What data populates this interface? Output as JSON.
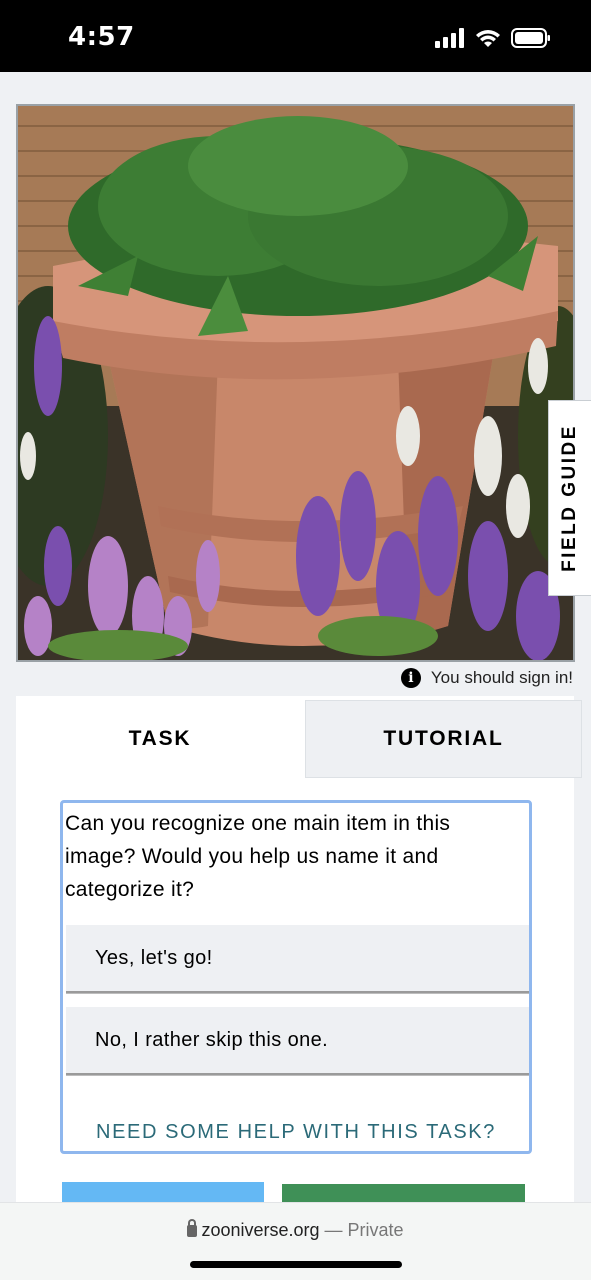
{
  "status_bar": {
    "time": "4:57",
    "icons": [
      "signal-icon",
      "wifi-icon",
      "battery-icon"
    ]
  },
  "subject": {
    "description_icon": "potted-plant-photo"
  },
  "field_guide": {
    "label": "FIELD GUIDE"
  },
  "notice": {
    "icon": "info-icon",
    "text": "You should sign in!"
  },
  "tabs": [
    {
      "label": "TASK",
      "active": true
    },
    {
      "label": "TUTORIAL",
      "active": false
    }
  ],
  "task": {
    "question": "Can you recognize one main item in this image? Would you help us name it and categorize it?",
    "answers": [
      "Yes, let's go!",
      "No, I rather skip this one."
    ],
    "help_link": "NEED SOME HELP WITH THIS TASK?"
  },
  "browser": {
    "domain": "zooniverse.org",
    "separator": " — ",
    "mode": "Private"
  },
  "colors": {
    "task_box_border": "#8fb7ee",
    "help_link": "#2b6a78",
    "button_blue": "#64b8f4",
    "button_green": "#3f9057"
  }
}
